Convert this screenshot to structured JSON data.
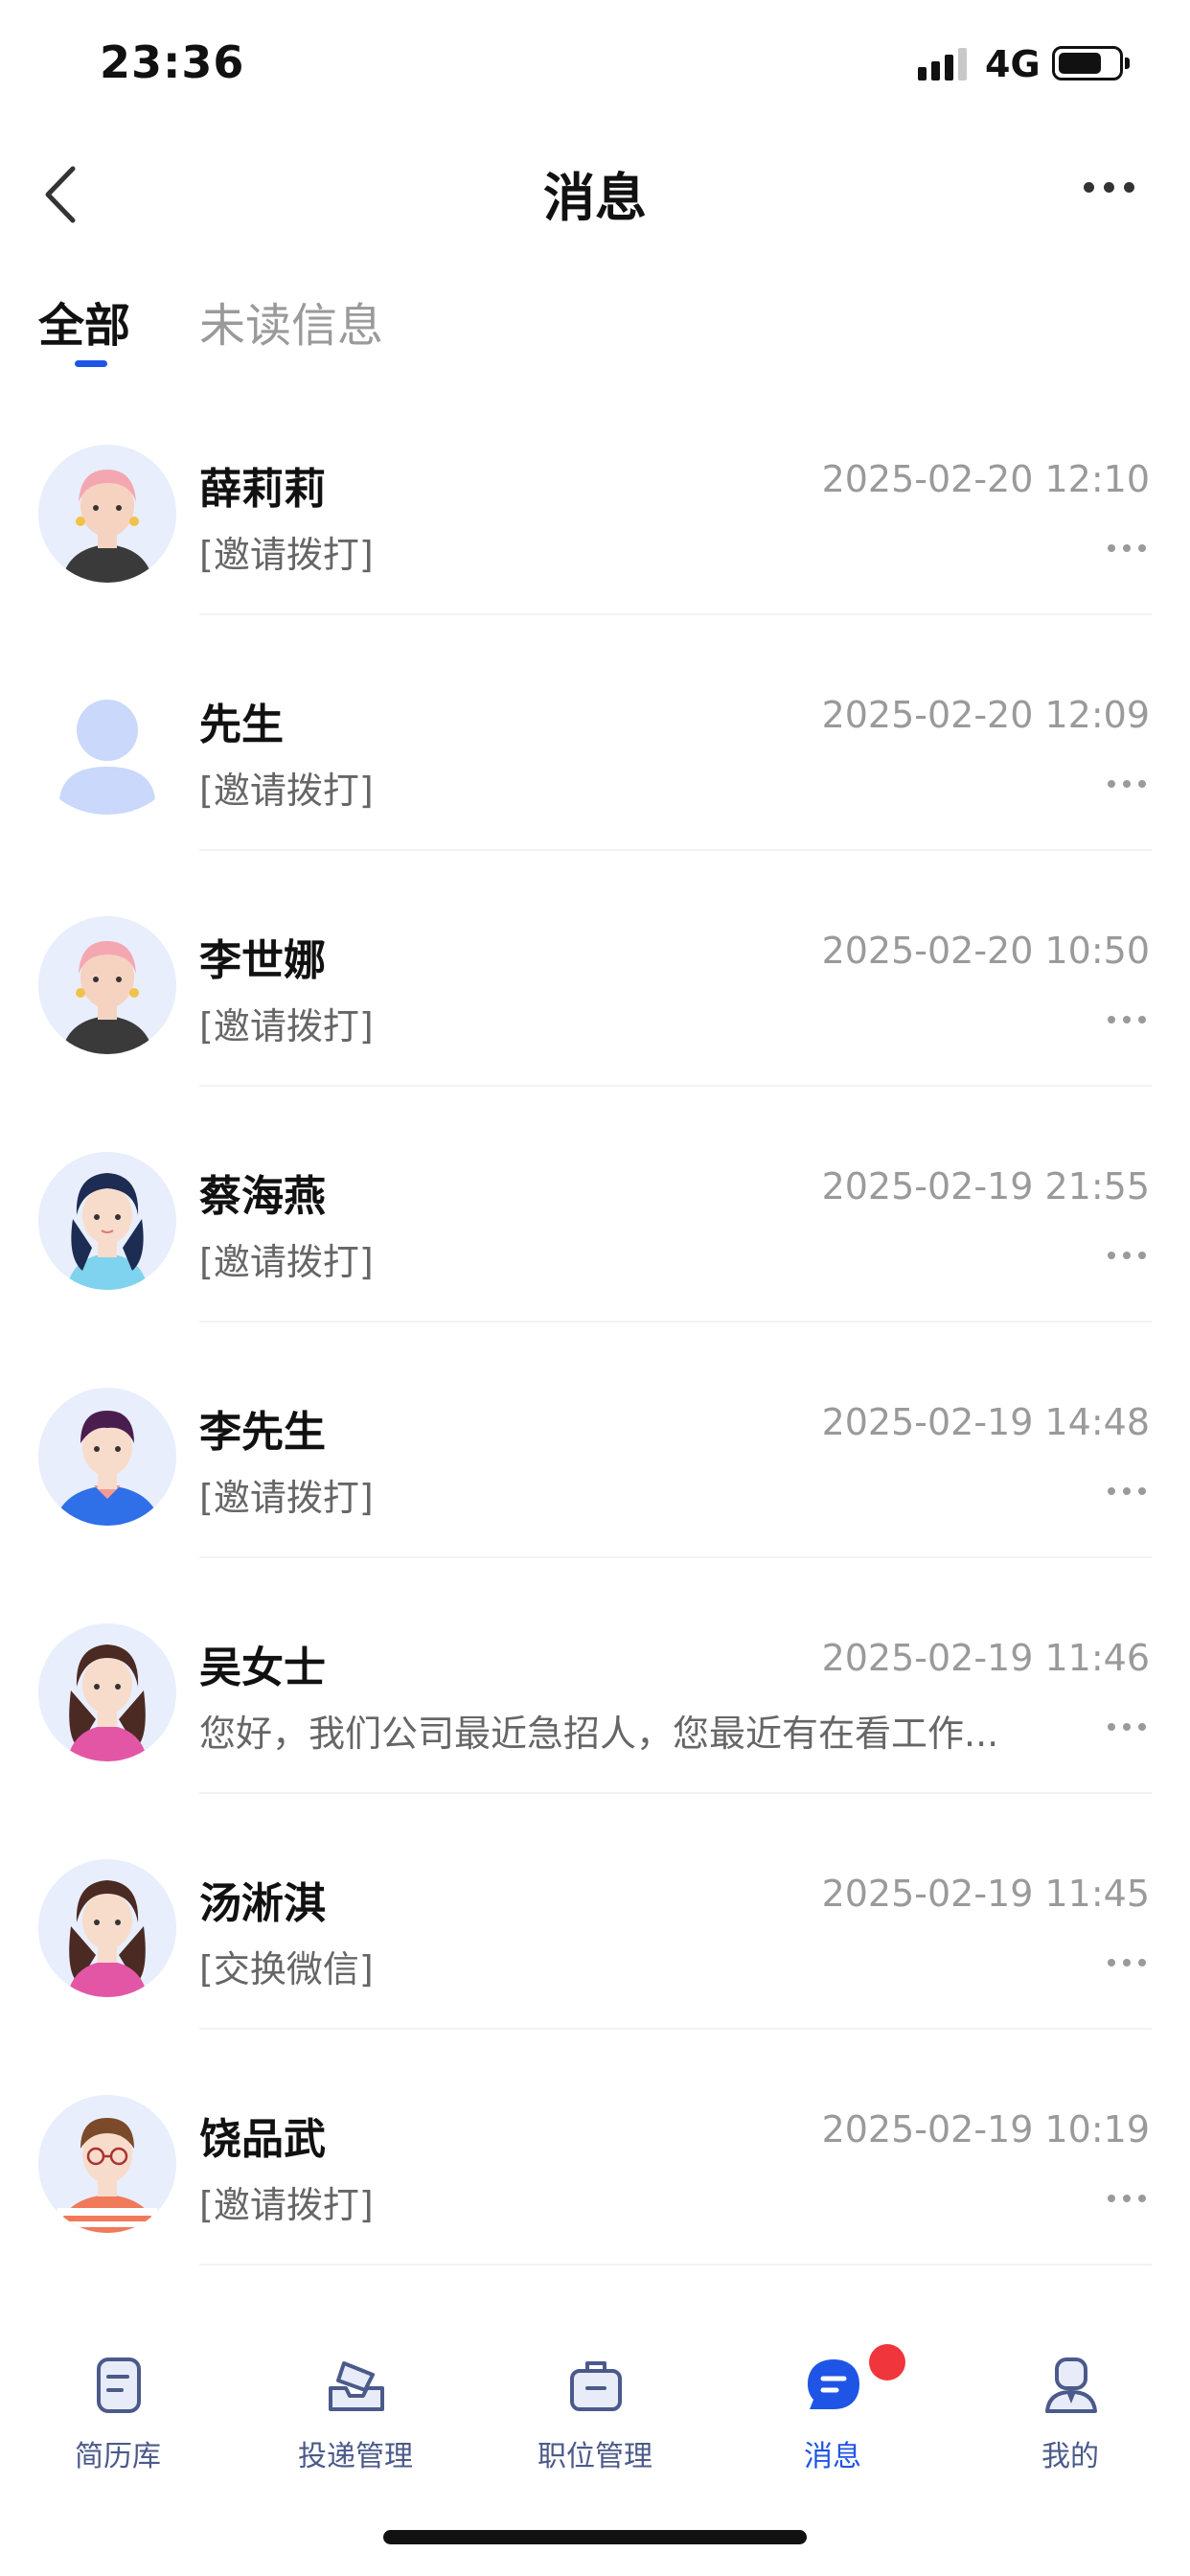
{
  "status_bar": {
    "time": "23:36",
    "network": "4G"
  },
  "nav": {
    "title": "消息"
  },
  "tabs": [
    {
      "label": "全部",
      "active": true
    },
    {
      "label": "未读信息",
      "active": false
    }
  ],
  "messages": [
    {
      "name": "薛莉莉",
      "time": "2025-02-20 12:10",
      "preview": "[邀请拨打]",
      "avatar": "woman-pink-hair-avatar"
    },
    {
      "name": "先生",
      "time": "2025-02-20 12:09",
      "preview": "[邀请拨打]",
      "avatar": "default-person-avatar"
    },
    {
      "name": "李世娜",
      "time": "2025-02-20 10:50",
      "preview": "[邀请拨打]",
      "avatar": "woman-pink-hair-avatar"
    },
    {
      "name": "蔡海燕",
      "time": "2025-02-19 21:55",
      "preview": "[邀请拨打]",
      "avatar": "woman-curly-hair-avatar"
    },
    {
      "name": "李先生",
      "time": "2025-02-19 14:48",
      "preview": "[邀请拨打]",
      "avatar": "man-blue-shirt-avatar"
    },
    {
      "name": "吴女士",
      "time": "2025-02-19 11:46",
      "preview": "您好，我们公司最近急招人，您最近有在看工作...",
      "avatar": "woman-long-hair-avatar"
    },
    {
      "name": "汤淅淇",
      "time": "2025-02-19 11:45",
      "preview": "[交换微信]",
      "avatar": "woman-long-hair-avatar"
    },
    {
      "name": "饶品武",
      "time": "2025-02-19 10:19",
      "preview": "[邀请拨打]",
      "avatar": "man-glasses-avatar"
    }
  ],
  "tab_bar": [
    {
      "label": "简历库",
      "icon": "document-icon",
      "active": false
    },
    {
      "label": "投递管理",
      "icon": "inbox-icon",
      "active": false
    },
    {
      "label": "职位管理",
      "icon": "briefcase-icon",
      "active": false
    },
    {
      "label": "消息",
      "icon": "chat-icon",
      "active": true,
      "badge": true
    },
    {
      "label": "我的",
      "icon": "profile-icon",
      "active": false
    }
  ],
  "colors": {
    "accent": "#1f55e6",
    "badge": "#f0363c",
    "muted": "#9a9a9a"
  }
}
